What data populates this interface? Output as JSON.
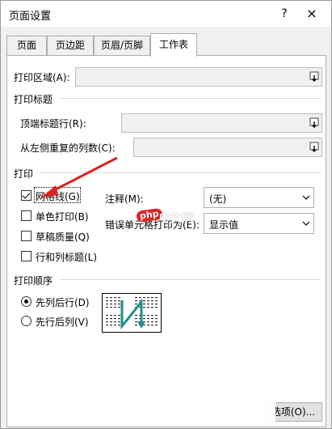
{
  "window": {
    "title": "页面设置",
    "help": "?",
    "close": "×"
  },
  "tabs": [
    {
      "label": "页面"
    },
    {
      "label": "页边距"
    },
    {
      "label": "页眉/页脚"
    },
    {
      "label": "工作表"
    }
  ],
  "print_area": {
    "label": "打印区域(A):",
    "value": ""
  },
  "print_titles": {
    "section": "打印标题",
    "rows_label": "顶端标题行(R):",
    "cols_label": "从左侧重复的列数(C):"
  },
  "print": {
    "section": "打印",
    "gridlines": {
      "label": "网格线(G)",
      "checked": true
    },
    "black_white": {
      "label": "单色打印(B)",
      "checked": false
    },
    "draft": {
      "label": "草稿质量(Q)",
      "checked": false
    },
    "headings": {
      "label": "行和列标题(L)",
      "checked": false
    },
    "comments_label": "注释(M):",
    "comments_value": "(无)",
    "errors_label": "错误单元格打印为(E):",
    "errors_value": "显示值"
  },
  "order": {
    "section": "打印顺序",
    "down_then_over": {
      "label": "先列后行(D)",
      "selected": true
    },
    "over_then_down": {
      "label": "先行后列(V)",
      "selected": false
    }
  },
  "options_button": "选项(O)...",
  "watermark": {
    "text": "php 中文网",
    "color": "#ffffff"
  },
  "colors": {
    "annotation_arrow": "#e02020",
    "preview_arrow": "#1e8f8a",
    "selected_tab_bg": "#ffffff"
  }
}
